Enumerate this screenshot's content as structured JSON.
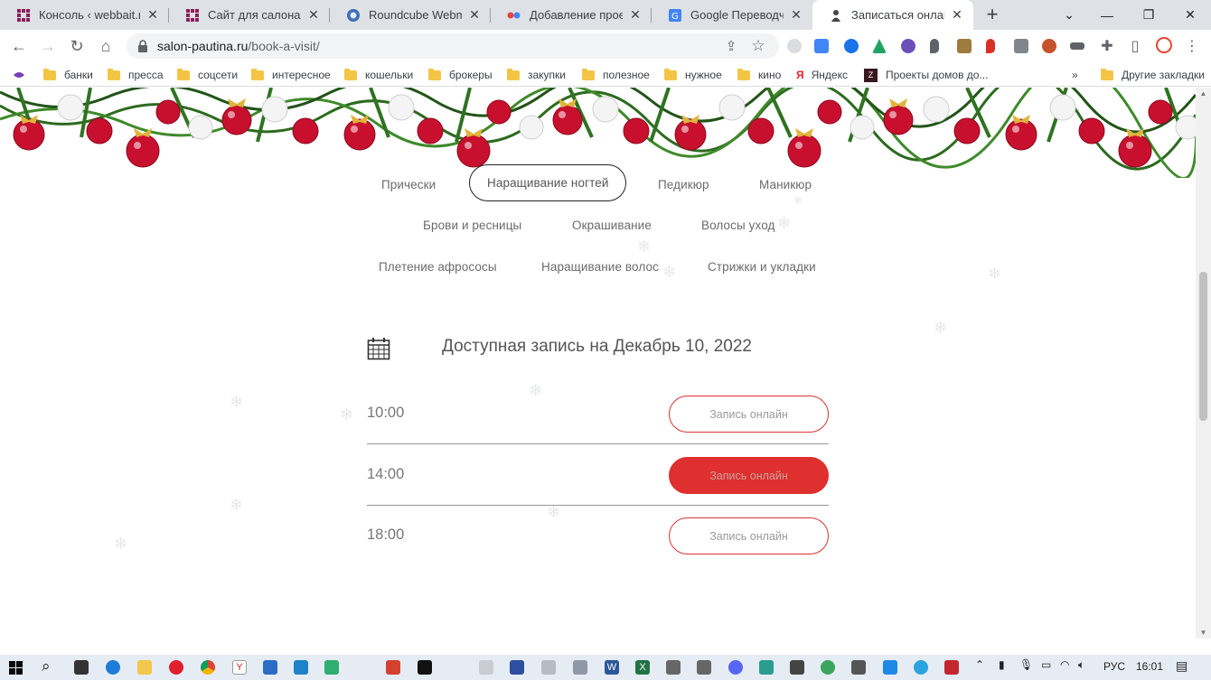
{
  "browser": {
    "tabs": [
      {
        "title": "Консоль ‹ webbait.ru",
        "icon": "webbait-icon",
        "active": false
      },
      {
        "title": "Сайт для салона крас",
        "icon": "webbait-icon",
        "active": false
      },
      {
        "title": "Roundcube Webmail",
        "icon": "roundcube-icon",
        "active": false
      },
      {
        "title": "Добавление проекта",
        "icon": "project-icon",
        "active": false
      },
      {
        "title": "Google Переводчик",
        "icon": "google-translate-icon",
        "active": false
      },
      {
        "title": "Записаться онлайн -",
        "icon": "salon-icon",
        "active": true
      }
    ],
    "new_tab_label": "+",
    "address": {
      "domain": "salon-pautina.ru",
      "path": "/book-a-visit/"
    }
  },
  "bookmarks": [
    {
      "label": "банки"
    },
    {
      "label": "пресса"
    },
    {
      "label": "соцсети"
    },
    {
      "label": "интересное"
    },
    {
      "label": "кошельки"
    },
    {
      "label": "брокеры"
    },
    {
      "label": "закупки"
    },
    {
      "label": "полезное"
    },
    {
      "label": "нужное"
    },
    {
      "label": "кино"
    },
    {
      "label": "Яндекс"
    },
    {
      "label": "Проекты домов до..."
    }
  ],
  "bookmarks_more": "»",
  "bookmarks_other": "Другие закладки",
  "services": {
    "row1": [
      "Прически",
      "Наращивание ногтей",
      "Педикюр",
      "Маникюр"
    ],
    "row2": [
      "Брови и ресницы",
      "Окрашивание",
      "Волосы уход"
    ],
    "row3": [
      "Плетение афросоcы",
      "Наращивание волос",
      "Стрижки и укладки"
    ],
    "selected": "Наращивание ногтей"
  },
  "booking": {
    "heading": "Доступная запись на Декабрь 10, 2022",
    "slots": [
      {
        "time": "10:00",
        "button": "Запись онлайн",
        "highlighted": false
      },
      {
        "time": "14:00",
        "button": "Запись онлайн",
        "highlighted": true
      },
      {
        "time": "18:00",
        "button": "Запись онлайн",
        "highlighted": false
      }
    ]
  },
  "taskbar": {
    "language": "РУС",
    "time": "16:01"
  },
  "colors": {
    "accent": "#e02f2f",
    "tab_strip": "#dee1e6",
    "taskbar": "#e6ecf3"
  }
}
